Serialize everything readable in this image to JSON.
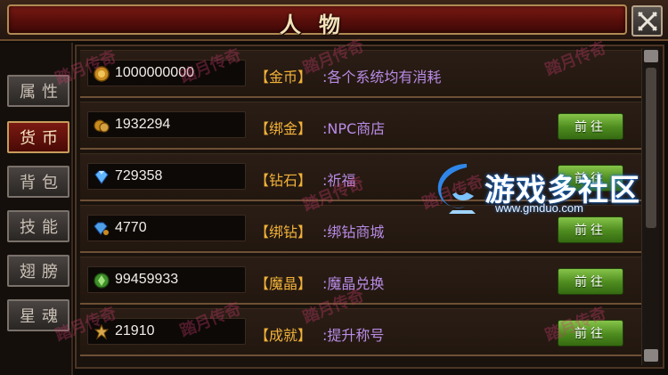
{
  "header": {
    "title": "人物"
  },
  "sidebar": {
    "tabs": [
      {
        "label": "属性",
        "active": false
      },
      {
        "label": "货币",
        "active": true
      },
      {
        "label": "背包",
        "active": false
      },
      {
        "label": "技能",
        "active": false
      },
      {
        "label": "翅膀",
        "active": false
      },
      {
        "label": "星魂",
        "active": false
      }
    ]
  },
  "currencies": [
    {
      "icon": "gold-coin-icon",
      "value": "1000000000",
      "label": "【金币】",
      "desc": ":各个系统均有消耗",
      "button": ""
    },
    {
      "icon": "bound-gold-icon",
      "value": "1932294",
      "label": "【绑金】",
      "desc": ":NPC商店",
      "button": "前往"
    },
    {
      "icon": "diamond-icon",
      "value": "729358",
      "label": "【钻石】",
      "desc": ":祈福",
      "button": "前往"
    },
    {
      "icon": "bound-diamond-icon",
      "value": "4770",
      "label": "【绑钻】",
      "desc": ":绑钻商城",
      "button": "前往"
    },
    {
      "icon": "magic-crystal-icon",
      "value": "99459933",
      "label": "【魔晶】",
      "desc": ":魔晶兑换",
      "button": "前往"
    },
    {
      "icon": "achievement-icon",
      "value": "21910",
      "label": "【成就】",
      "desc": ":提升称号",
      "button": "前往"
    }
  ],
  "watermark": {
    "text": "踏月传奇"
  },
  "logo": {
    "name": "游戏多社区",
    "url": "www.gmduo.com"
  },
  "colors": {
    "label": "#f2b23a",
    "desc": "#b98be6",
    "button": "#4d8a1e",
    "active_tab": "#7a1a12"
  }
}
